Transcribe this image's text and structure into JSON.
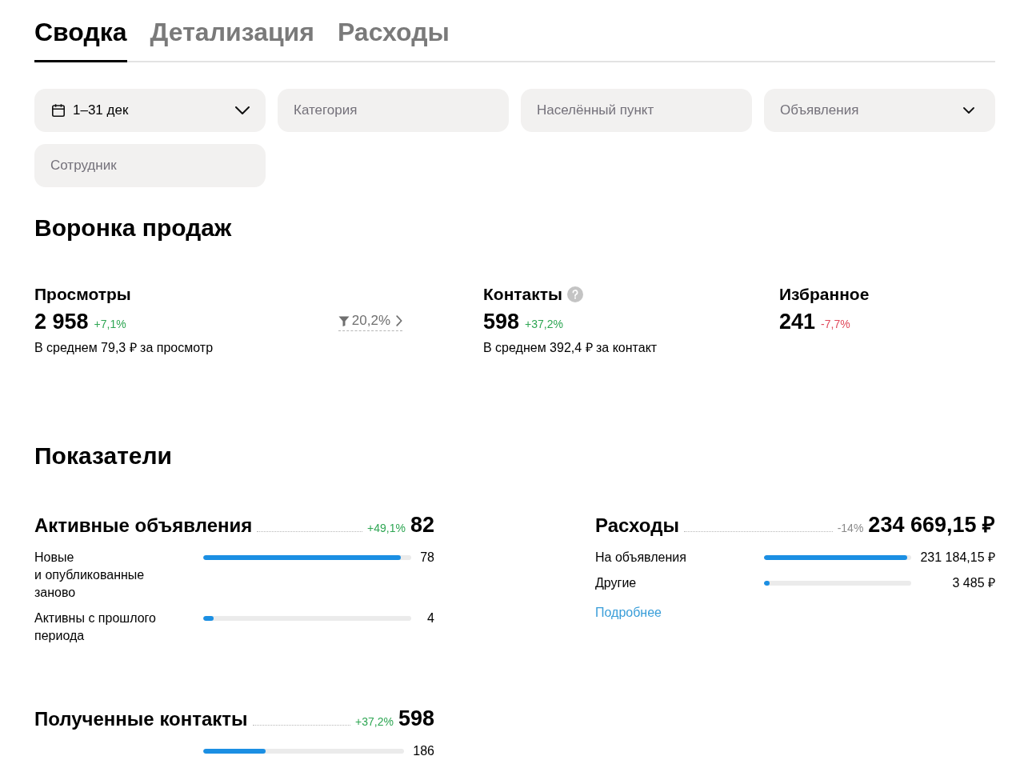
{
  "tabs": [
    {
      "label": "Сводка",
      "selected": true
    },
    {
      "label": "Детализация",
      "selected": false
    },
    {
      "label": "Расходы",
      "selected": false
    }
  ],
  "filters": [
    {
      "kind": "date",
      "value": "1–31 дек"
    },
    {
      "kind": "text",
      "placeholder": "Категория"
    },
    {
      "kind": "text",
      "placeholder": "Населённый пункт"
    },
    {
      "kind": "select",
      "placeholder": "Объявления"
    },
    {
      "kind": "text",
      "placeholder": "Сотрудник"
    }
  ],
  "funnel": {
    "title": "Воронка продаж",
    "metrics": [
      {
        "label": "Просмотры",
        "value": "2 958",
        "change": "+7,1%",
        "color": "#2ea653",
        "conversion": "20,2%",
        "average": "В среднем 79,3 ₽ за просмотр"
      },
      {
        "label": "Контакты",
        "help": true,
        "value": "598",
        "change": "+37,2%",
        "color": "#2ea653",
        "average": "В среднем 392,4 ₽ за контакт"
      },
      {
        "label": "Избранное",
        "value": "241",
        "change": "-7,7%",
        "color": "#e04a5c"
      }
    ]
  },
  "indicators": {
    "title": "Показатели",
    "panels": [
      {
        "title": "Активные объявления",
        "change": "+49,1%",
        "color": "#2ea653",
        "total": "82",
        "rows": [
          {
            "label": "Новые\nи опубликованные заново",
            "level": 0.95,
            "value": "78"
          },
          {
            "label": "Активны с прошлого периода",
            "level": 0.05,
            "value": "4"
          }
        ]
      },
      {
        "title": "Расходы",
        "change": "-14%",
        "color": "#8a8a8a",
        "total": "234 669,15 ₽",
        "rows": [
          {
            "label": "На объявления",
            "level": 0.97,
            "value": "231 184,15 ₽"
          },
          {
            "label": "Другие",
            "level": 0.04,
            "value": "3 485 ₽"
          }
        ],
        "link": "Подробнее"
      },
      {
        "title": "Полученные контакты",
        "change": "+37,2%",
        "color": "#2ea653",
        "total": "598",
        "rows": [
          {
            "level": 0.31,
            "value": "186"
          }
        ]
      }
    ]
  }
}
